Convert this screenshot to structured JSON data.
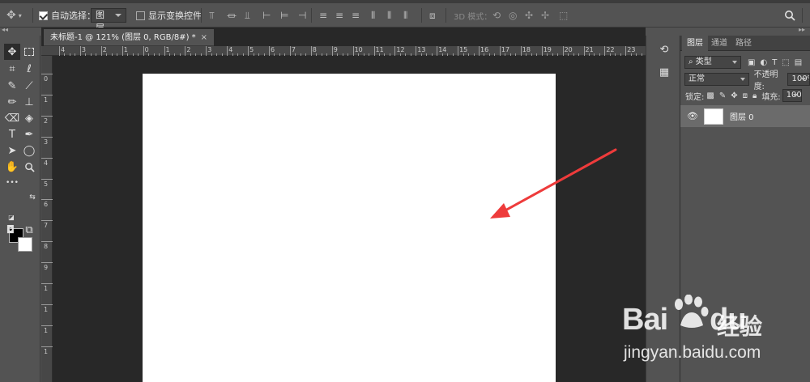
{
  "options_bar": {
    "auto_select_label": "自动选择：",
    "auto_select_checked": true,
    "layer_target": "图层",
    "show_transform_label": "显示变换控件",
    "show_transform_checked": false,
    "mode_3d_label": "3D 模式："
  },
  "document": {
    "tab_title": "未标题-1 @ 121% (图层 0, RGB/8#) *",
    "close_glyph": "×",
    "ruler_top_labels": [
      "4",
      "3",
      "2",
      "1",
      "0",
      "1",
      "2",
      "3",
      "4",
      "5",
      "6",
      "7",
      "8",
      "9",
      "10",
      "11",
      "12",
      "13",
      "14",
      "15",
      "16",
      "17",
      "18",
      "19",
      "20",
      "21",
      "22",
      "23"
    ],
    "ruler_left_labels": [
      "0",
      "1",
      "2",
      "3",
      "4",
      "5",
      "6",
      "7",
      "8",
      "9",
      "1",
      "1",
      "1",
      "1"
    ]
  },
  "toolbar": {
    "foreground_color": "#000000",
    "background_color": "#ffffff",
    "more_glyph": "•••"
  },
  "layers_panel": {
    "tabs": [
      "图层",
      "通道",
      "路径"
    ],
    "active_tab": "图层",
    "filter_kind": "类型",
    "blend_mode": "正常",
    "opacity_label": "不透明度:",
    "opacity_value": "100%",
    "lock_label": "锁定:",
    "fill_label": "填充:",
    "fill_value": "100%",
    "layers": [
      {
        "name": "图层 0",
        "visible": true
      }
    ]
  },
  "annotation": {
    "arrow_color": "#ee3b3b"
  },
  "watermark": {
    "brand": "Bai",
    "brand2": "du",
    "cn": "经验",
    "url": "jingyan.baidu.com"
  }
}
